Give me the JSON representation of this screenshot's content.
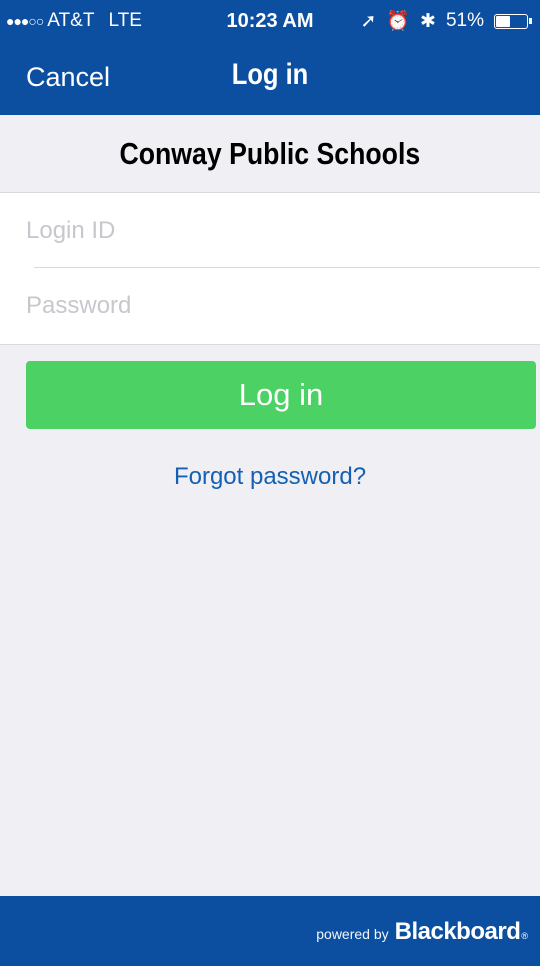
{
  "status_bar": {
    "signal": "●●●○○",
    "carrier": "AT&T",
    "network": "LTE",
    "time": "10:23 AM",
    "location_icon": "➚",
    "alarm_icon": "⏰",
    "bluetooth_icon": "✱",
    "battery_percent": "51%",
    "battery_level": 0.51
  },
  "nav": {
    "cancel_label": "Cancel",
    "title": "Log in"
  },
  "school_name": "Conway Public Schools",
  "form": {
    "login_id": {
      "placeholder": "Login ID",
      "value": ""
    },
    "password": {
      "placeholder": "Password",
      "value": ""
    }
  },
  "login_button_label": "Log in",
  "forgot_password_label": "Forgot password?",
  "footer": {
    "powered_by": "powered by",
    "brand": "Blackboard",
    "trademark": "®"
  },
  "colors": {
    "brand_blue": "#0c4fa1",
    "login_green": "#4cd164",
    "link_blue": "#1560b2",
    "background": "#efeff4"
  }
}
